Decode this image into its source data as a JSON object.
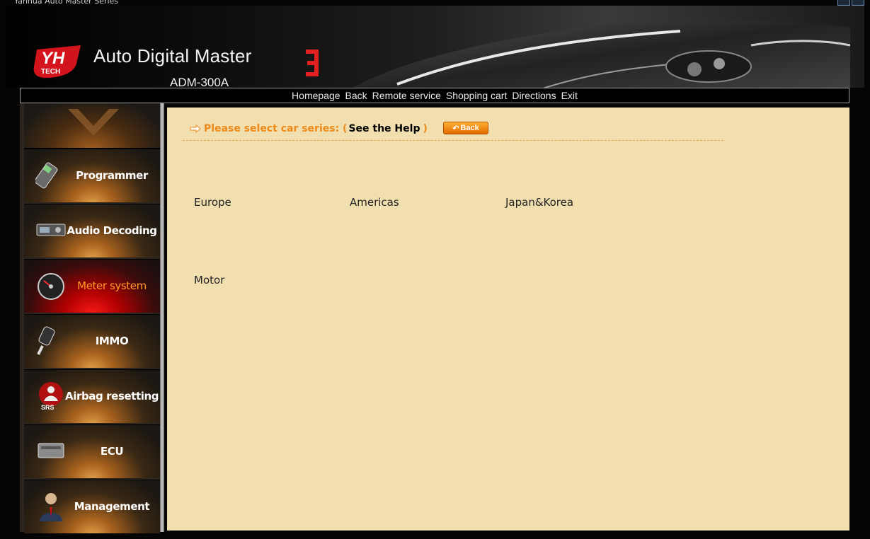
{
  "window": {
    "title": "Yanhua Auto Master Series"
  },
  "header": {
    "product_title": "Auto Digital Master",
    "model": "ADM-300A",
    "logo_text": "TECH"
  },
  "nav": [
    "Homepage",
    "Back",
    "Remote service",
    "Shopping cart",
    "Directions",
    "Exit"
  ],
  "sidebar": {
    "items": [
      {
        "label": "Programmer",
        "icon": "programmer-icon",
        "active": false
      },
      {
        "label": "Audio Decoding",
        "icon": "car-radio-icon",
        "active": false
      },
      {
        "label": "Meter system",
        "icon": "speedometer-icon",
        "active": true
      },
      {
        "label": "IMMO",
        "icon": "car-key-icon",
        "active": false
      },
      {
        "label": "Airbag resetting",
        "icon": "airbag-srs-icon",
        "active": false
      },
      {
        "label": "ECU",
        "icon": "ecu-module-icon",
        "active": false
      },
      {
        "label": "Management",
        "icon": "user-manager-icon",
        "active": false
      }
    ]
  },
  "main": {
    "prompt": "Please select car series: (",
    "help_link": "See the Help",
    "prompt_close": ")",
    "back_button": "Back",
    "series": [
      "Europe",
      "Americas",
      "Japan&Korea",
      "Motor"
    ]
  },
  "colors": {
    "content_bg": "#f2dfb0",
    "accent_orange": "#ee8a1a",
    "active_red": "#d00000"
  }
}
